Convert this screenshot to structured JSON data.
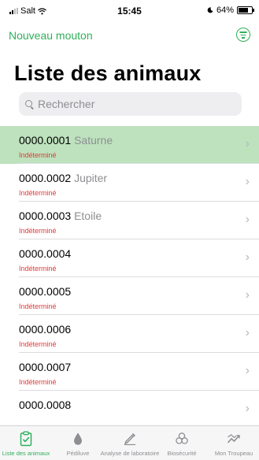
{
  "status_bar": {
    "carrier": "Salt",
    "time": "15:45",
    "battery": "64%"
  },
  "nav": {
    "new_label": "Nouveau mouton"
  },
  "page": {
    "title": "Liste des animaux"
  },
  "search": {
    "placeholder": "Rechercher"
  },
  "animals": [
    {
      "number": "0000.0001",
      "name": "Saturne",
      "status": "Indéterminé",
      "selected": true
    },
    {
      "number": "0000.0002",
      "name": "Jupiter",
      "status": "Indéterminé"
    },
    {
      "number": "0000.0003",
      "name": "Etoile",
      "status": "Indéterminé"
    },
    {
      "number": "0000.0004",
      "name": "",
      "status": "Indéterminé"
    },
    {
      "number": "0000.0005",
      "name": "",
      "status": "Indéterminé"
    },
    {
      "number": "0000.0006",
      "name": "",
      "status": "Indéterminé"
    },
    {
      "number": "0000.0007",
      "name": "",
      "status": "Indéterminé"
    },
    {
      "number": "0000.0008",
      "name": "",
      "status": ""
    }
  ],
  "tabs": [
    {
      "label": "Liste des animaux",
      "icon": "clipboard-check-icon",
      "active": true
    },
    {
      "label": "Pédiluve",
      "icon": "drop-icon"
    },
    {
      "label": "Analyse de laboratoire",
      "icon": "pipette-icon"
    },
    {
      "label": "Biosécurité",
      "icon": "biohazard-icon"
    },
    {
      "label": "Mon Troupeau",
      "icon": "trend-chart-icon"
    }
  ],
  "colors": {
    "accent": "#2fb05a",
    "status_red": "#e03a3a",
    "selected_row": "#bde2bd"
  }
}
